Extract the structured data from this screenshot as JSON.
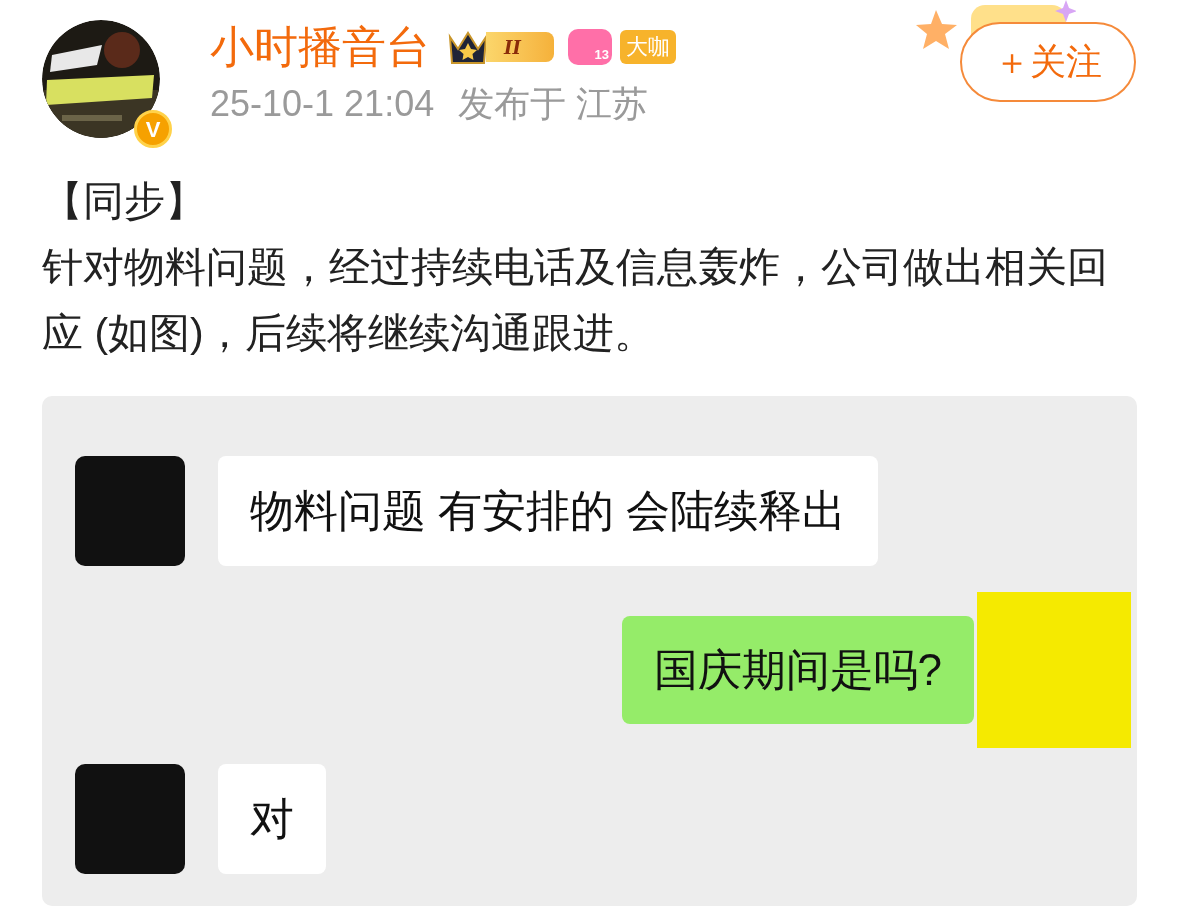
{
  "author": {
    "name": "小时播音台",
    "verified_mark": "V",
    "level": "II",
    "fan_level": "13",
    "tag": "大咖",
    "time": "25-10-1 21:04",
    "location": "发布于 江苏"
  },
  "follow_button": {
    "label": "＋关注"
  },
  "post": {
    "title": "【同步】",
    "body": "针对物料问题，经过持续电话及信息轰炸，公司做出相关回应 (如图)，后续将继续沟通跟进。"
  },
  "chat": [
    {
      "kind": "incoming",
      "text": "物料问题 有安排的 会陆续释出",
      "color": "#111111"
    },
    {
      "kind": "outgoing",
      "text": "国庆期间是吗?",
      "color": "#f5ea00"
    },
    {
      "kind": "incoming",
      "text": "对",
      "color": "#111111"
    }
  ]
}
